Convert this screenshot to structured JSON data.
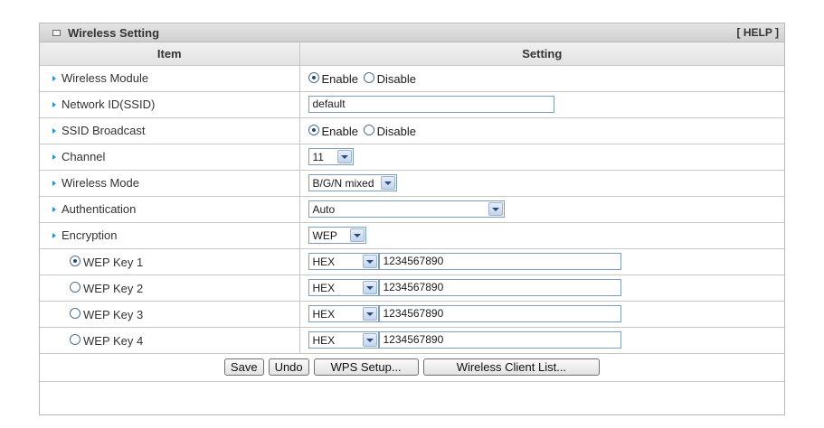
{
  "panel": {
    "title": "Wireless Setting",
    "help": "[ HELP ]",
    "col_item": "Item",
    "col_setting": "Setting"
  },
  "rows": {
    "wireless_module": {
      "label": "Wireless Module",
      "enable": "Enable",
      "disable": "Disable",
      "selected": "Enable"
    },
    "ssid": {
      "label": "Network ID(SSID)",
      "value": "default"
    },
    "ssid_broadcast": {
      "label": "SSID Broadcast",
      "enable": "Enable",
      "disable": "Disable",
      "selected": "Enable"
    },
    "channel": {
      "label": "Channel",
      "value": "11"
    },
    "mode": {
      "label": "Wireless Mode",
      "value": "B/G/N mixed"
    },
    "auth": {
      "label": "Authentication",
      "value": "Auto"
    },
    "encryption": {
      "label": "Encryption",
      "value": "WEP"
    },
    "wep1": {
      "label": "WEP Key 1",
      "format": "HEX",
      "key": "1234567890",
      "selected": true
    },
    "wep2": {
      "label": "WEP Key 2",
      "format": "HEX",
      "key": "1234567890",
      "selected": false
    },
    "wep3": {
      "label": "WEP Key 3",
      "format": "HEX",
      "key": "1234567890",
      "selected": false
    },
    "wep4": {
      "label": "WEP Key 4",
      "format": "HEX",
      "key": "1234567890",
      "selected": false
    }
  },
  "buttons": {
    "save": "Save",
    "undo": "Undo",
    "wps": "WPS Setup...",
    "client_list": "Wireless Client List..."
  },
  "colors": {
    "accent_arrow": "#2a93c9",
    "header_bg": "#d8d8d8",
    "border": "#c6c6c6"
  }
}
